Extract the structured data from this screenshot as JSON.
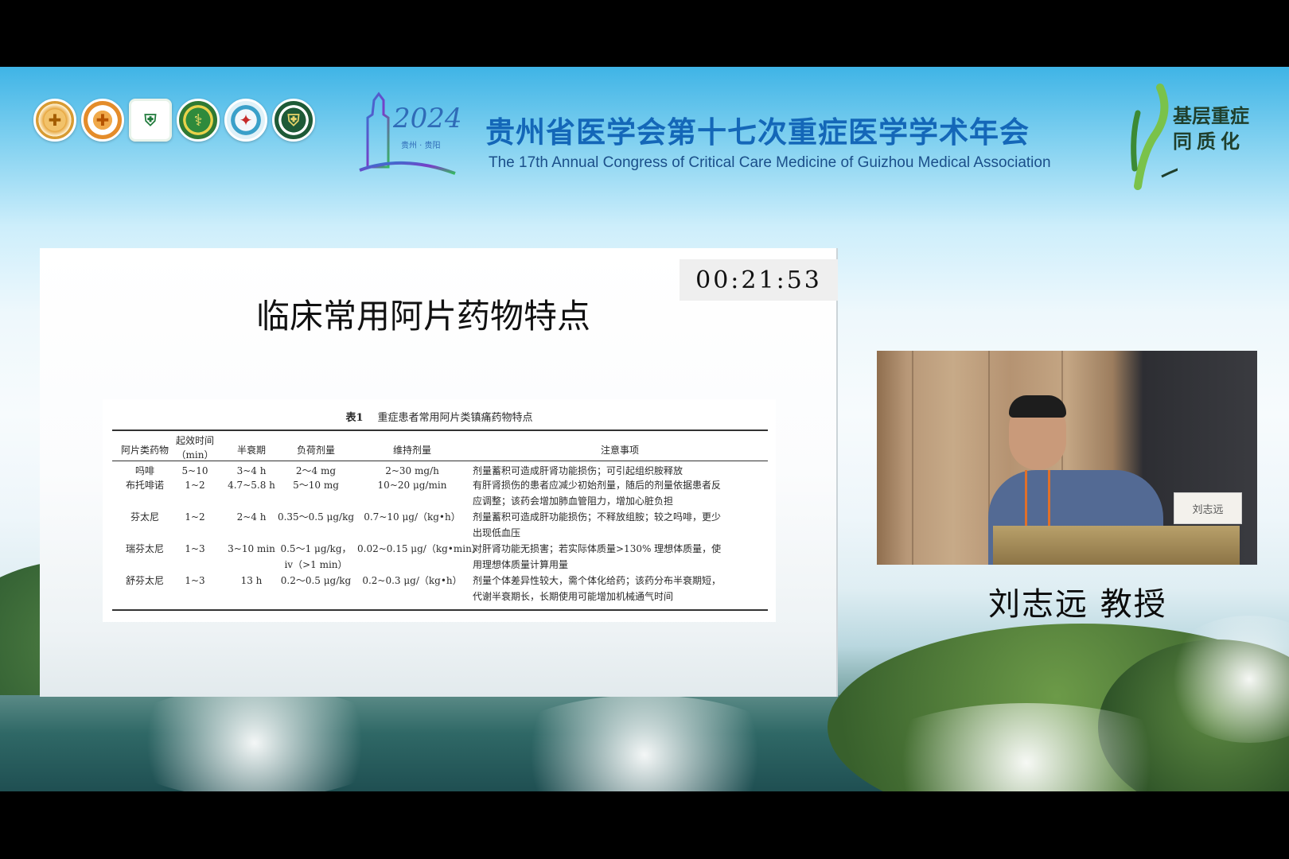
{
  "conference": {
    "year_mark": "2024",
    "year_place": "贵州 · 贵阳",
    "title_cn": "贵州省医学会第十七次重症医学学术年会",
    "title_en": "The 17th Annual Congress of Critical Care Medicine of Guizhou Medical Association",
    "brand_line1": "基层重症",
    "brand_line2": "同质化"
  },
  "logos": [
    {
      "icon": "org-seal-1-icon"
    },
    {
      "icon": "org-seal-2-icon"
    },
    {
      "icon": "org-shield-icon"
    },
    {
      "icon": "org-seal-4-icon"
    },
    {
      "icon": "org-seal-5-icon"
    },
    {
      "icon": "org-seal-6-icon"
    }
  ],
  "slide": {
    "title": "临床常用阿片药物特点",
    "timer": "00:21:53",
    "table": {
      "caption_label": "表1",
      "caption_text": "重症患者常用阿片类镇痛药物特点",
      "headers": {
        "drug": "阿片类药物",
        "onset_l1": "起效时间",
        "onset_l2": "（min）",
        "halflife": "半衰期",
        "loading": "负荷剂量",
        "maintenance": "维持剂量",
        "notes": "注意事项"
      },
      "rows": [
        {
          "drug": "吗啡",
          "onset": "5~10",
          "halflife": "3~4 h",
          "loading": "2～4 mg",
          "maintenance": "2~30 mg/h",
          "notes1": "剂量蓄积可造成肝肾功能损伤；可引起组织胺释放",
          "notes2": ""
        },
        {
          "drug": "布托啡诺",
          "onset": "1~2",
          "halflife": "4.7~5.8 h",
          "loading": "5～10 mg",
          "maintenance": "10~20 μg/min",
          "notes1": "有肝肾损伤的患者应减少初始剂量，随后的剂量依据患者反",
          "notes2": "应调整；该药会增加肺血管阻力，增加心脏负担"
        },
        {
          "drug": "芬太尼",
          "onset": "1~2",
          "halflife": "2~4 h",
          "loading": "0.35～0.5 μg/kg",
          "maintenance": "0.7~10 μg/（kg•h）",
          "notes1": "剂量蓄积可造成肝功能损伤；不释放组胺；较之吗啡，更少",
          "notes2": "出现低血压"
        },
        {
          "drug": "瑞芬太尼",
          "onset": "1~3",
          "halflife": "3~10 min",
          "loading": "0.5～1 μg/kg，",
          "loading2": "iv（>1 min）",
          "maintenance": "0.02~0.15 μg/（kg•min）",
          "notes1": "对肝肾功能无损害；若实际体质量>130% 理想体质量，使",
          "notes2": "用理想体质量计算用量"
        },
        {
          "drug": "舒芬太尼",
          "onset": "1~3",
          "halflife": "13 h",
          "loading": "0.2～0.5 μg/kg",
          "maintenance": "0.2~0.3 μg/（kg•h）",
          "notes1": "剂量个体差异性较大，需个体化给药；该药分布半衰期短，",
          "notes2": "代谢半衰期长，长期使用可能增加机械通气时间"
        }
      ]
    }
  },
  "speaker": {
    "name": "刘志远  教授",
    "nameplate": "刘志远"
  },
  "colors": {
    "title_blue": "#1467b8",
    "brand_green": "#1f3f2c",
    "timer_bg": "#efefef"
  }
}
